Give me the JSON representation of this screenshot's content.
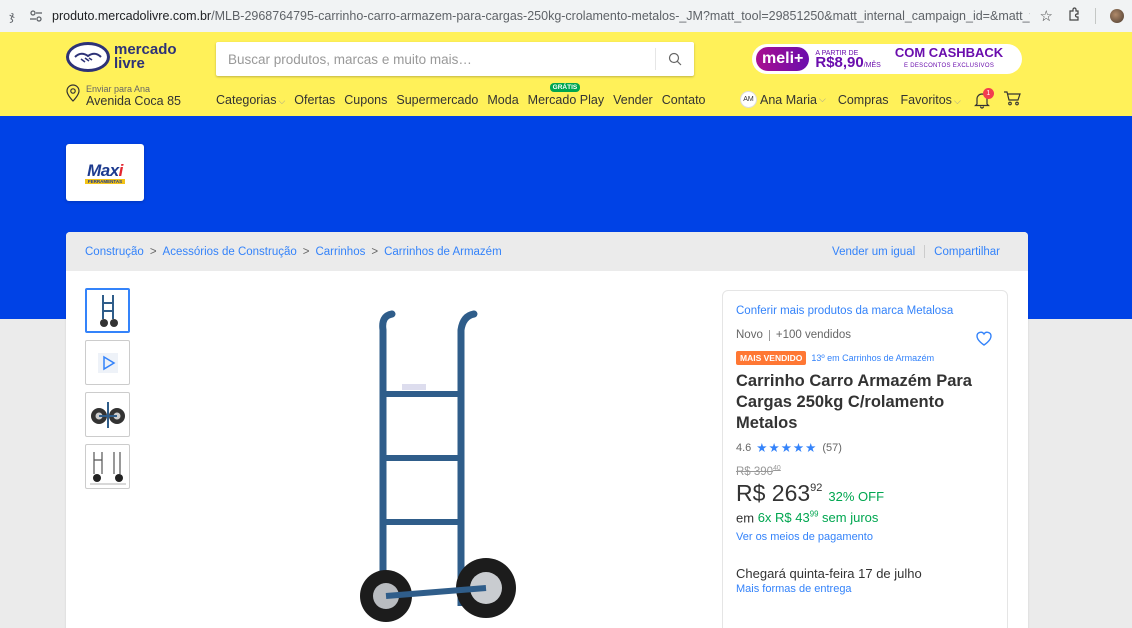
{
  "browser": {
    "tab_fragment": "ჯ",
    "url_host": "produto.mercadolivre.com.br",
    "url_path": "/MLB-2968764795-carrinho-carro-armazem-para-cargas-250kg-crolamento-metalos-_JM?matt_tool=29851250&matt_internal_campaign_id=&matt_word=&matt_..."
  },
  "header": {
    "logo_line1": "mercado",
    "logo_line2": "livre",
    "search_placeholder": "Buscar produtos, marcas e muito mais…",
    "promo": {
      "brand": "meli+",
      "from_label": "A PARTIR DE",
      "price": "R$8,90",
      "per": "/MÊS",
      "cashback": "COM CASHBACK",
      "cashback_sub": "E DESCONTOS EXCLUSIVOS"
    },
    "ship_to": "Enviar para Ana",
    "address": "Avenida Coca 85",
    "nav": [
      "Categorias",
      "Ofertas",
      "Cupons",
      "Supermercado",
      "Moda",
      "Mercado Play",
      "Vender",
      "Contato"
    ],
    "nav_badge": "GRÁTIS",
    "avatar_initials": "AM",
    "user_name": "Ana Maria",
    "purchases": "Compras",
    "favorites": "Favoritos",
    "notif_count": "1"
  },
  "store": {
    "logo_text_a": "Max",
    "logo_text_b": "i",
    "logo_sub": "FERRAMENTAS"
  },
  "breadcrumb": {
    "items": [
      "Construção",
      "Acessórios de Construção",
      "Carrinhos",
      "Carrinhos de Armazém"
    ],
    "sep": ">",
    "sell_same": "Vender um igual",
    "share": "Compartilhar"
  },
  "product": {
    "brand_link": "Conferir mais produtos da marca Metalosa",
    "condition": "Novo",
    "sold": "+100 vendidos",
    "best_seller": "MAIS VENDIDO",
    "rank": "13º em Carrinhos de Armazém",
    "title": "Carrinho Carro Armazém Para Cargas 250kg C/rolamento Metalos",
    "rating": "4.6",
    "stars": "★★★★★",
    "rating_value": 4.6,
    "reviews": "(57)",
    "old_price_int": "R$ 390",
    "old_price_cents": "40",
    "price_int": "R$ 263",
    "price_cents": "92",
    "discount": "32% OFF",
    "installments_prefix": "em",
    "installments_main": "6x R$ 43",
    "installments_cents": "99",
    "installments_suffix": "sem juros",
    "payment_link": "Ver os meios de pagamento",
    "arrival": "Chegará quinta-feira 17 de julho",
    "more_shipping": "Mais formas de entrega"
  },
  "colors": {
    "header_yellow": "#fff159",
    "store_blue": "#0042e6",
    "link_blue": "#3483fa",
    "green": "#00a650",
    "best_seller_orange": "#ff7733"
  }
}
